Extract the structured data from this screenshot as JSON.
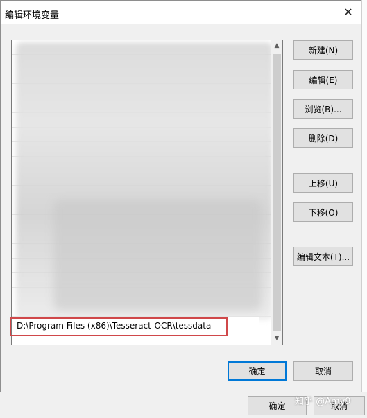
{
  "dialog": {
    "title": "编辑环境变量",
    "close_glyph": "✕"
  },
  "list": {
    "selected_entry": "D:\\Program Files (x86)\\Tesseract-OCR\\tessdata",
    "scroll_up_glyph": "▲",
    "scroll_down_glyph": "▼"
  },
  "buttons": {
    "new": "新建(N)",
    "edit": "编辑(E)",
    "browse": "浏览(B)...",
    "delete": "删除(D)",
    "move_up": "上移(U)",
    "move_down": "下移(O)",
    "edit_text": "编辑文本(T)...",
    "ok": "确定",
    "cancel": "取消"
  },
  "background_window": {
    "ok": "确定",
    "cancel": "取消"
  },
  "watermark": "知乎 @Amy9",
  "colors": {
    "highlight_box": "#d0484a",
    "primary_border": "#0078d7"
  }
}
